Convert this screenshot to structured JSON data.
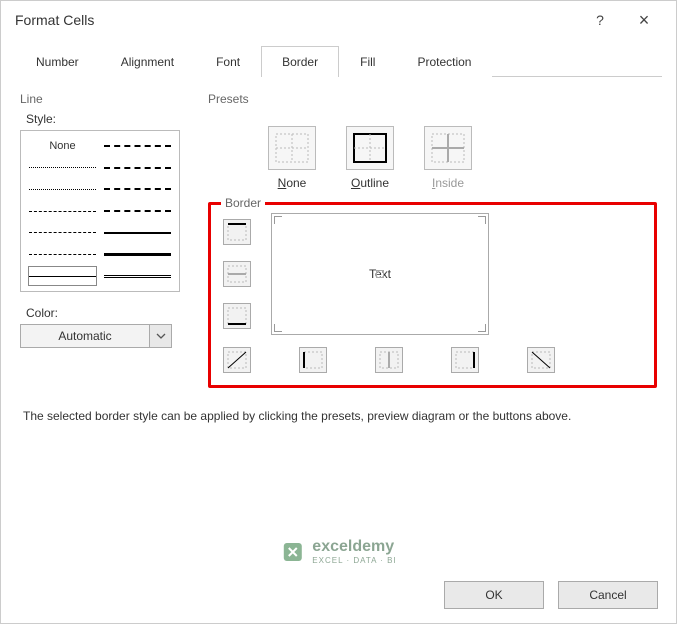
{
  "dialog": {
    "title": "Format Cells"
  },
  "titlebar": {
    "help": "?",
    "close": "×"
  },
  "tabs": [
    "Number",
    "Alignment",
    "Font",
    "Border",
    "Fill",
    "Protection"
  ],
  "active_tab": "Border",
  "line": {
    "group_label": "Line",
    "style_label": "Style:",
    "none_label": "None",
    "color_label": "Color:",
    "color_value": "Automatic"
  },
  "presets": {
    "group_label": "Presets",
    "items": [
      {
        "label_pre": "",
        "label_u": "N",
        "label_post": "one"
      },
      {
        "label_pre": "",
        "label_u": "O",
        "label_post": "utline"
      },
      {
        "label_pre": "",
        "label_u": "I",
        "label_post": "nside"
      }
    ]
  },
  "border": {
    "group_label": "Border",
    "preview_text": "Text"
  },
  "hint": "The selected border style can be applied by clicking the presets, preview diagram or the buttons above.",
  "watermark": {
    "brand": "exceldemy",
    "sub": "EXCEL · DATA · BI"
  },
  "footer": {
    "ok": "OK",
    "cancel": "Cancel"
  }
}
